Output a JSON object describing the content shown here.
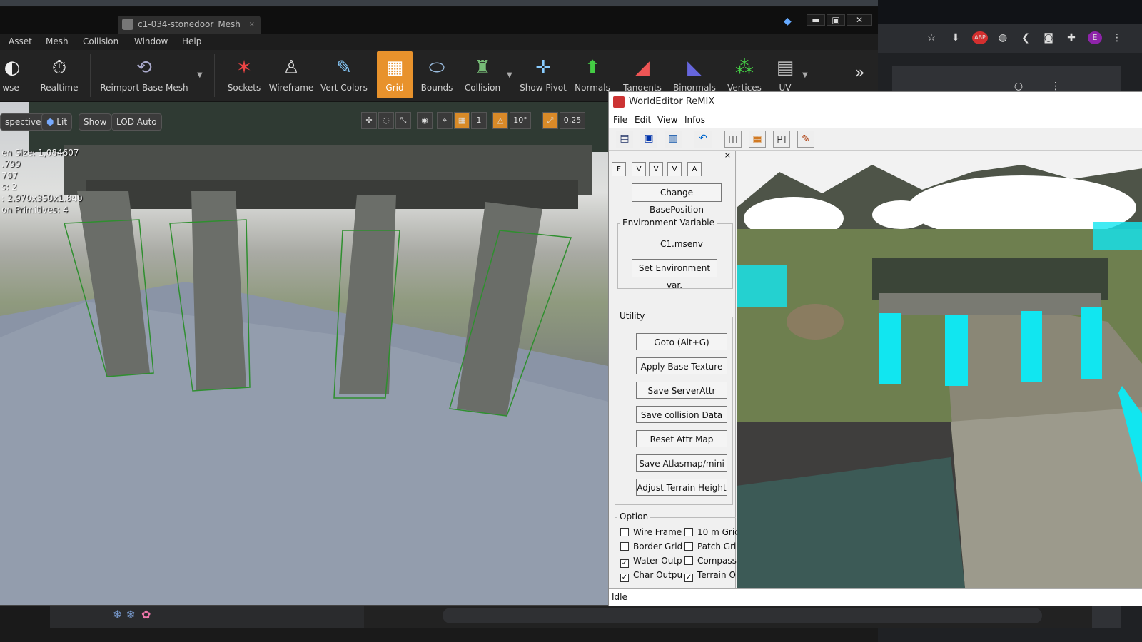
{
  "ue": {
    "tab_title": "c1-034-stonedoor_Mesh",
    "tab_close": "×",
    "window_buttons": {
      "minimize": "▬",
      "maximize": "▣",
      "close": "✕"
    },
    "menu": [
      "Asset",
      "Mesh",
      "Collision",
      "Window",
      "Help"
    ],
    "toolbar": [
      {
        "label": "wse",
        "icon": "browse-icon"
      },
      {
        "label": "Realtime",
        "icon": "realtime-icon"
      },
      {
        "label": "Reimport Base Mesh",
        "icon": "reimport-icon"
      },
      {
        "label": "Sockets",
        "icon": "sockets-icon"
      },
      {
        "label": "Wireframe",
        "icon": "wireframe-icon"
      },
      {
        "label": "Vert Colors",
        "icon": "vert-colors-icon"
      },
      {
        "label": "Grid",
        "icon": "grid-icon",
        "active": true
      },
      {
        "label": "Bounds",
        "icon": "bounds-icon"
      },
      {
        "label": "Collision",
        "icon": "collision-icon"
      },
      {
        "label": "Show Pivot",
        "icon": "show-pivot-icon"
      },
      {
        "label": "Normals",
        "icon": "normals-icon"
      },
      {
        "label": "Tangents",
        "icon": "tangents-icon"
      },
      {
        "label": "Binormals",
        "icon": "binormals-icon"
      },
      {
        "label": "Vertices",
        "icon": "vertices-icon"
      },
      {
        "label": "UV",
        "icon": "uv-icon"
      }
    ],
    "viewport": {
      "perspective": "spective",
      "lit": "Lit",
      "show": "Show",
      "lod": "LOD Auto",
      "grid_size": "1",
      "rotation_snap": "10°",
      "scale_snap": "0,25",
      "stats": [
        "en Size:  1,084607",
        ".799",
        "707",
        "s:  2",
        ":  2.970x350x1.840",
        "on Primitives:  4"
      ]
    }
  },
  "world_editor": {
    "title": "WorldEditor ReMIX",
    "menu": [
      "File",
      "Edit",
      "View",
      "Infos"
    ],
    "panel": {
      "close": "×",
      "tabs": [
        "F",
        "V",
        "V",
        "V",
        "A"
      ],
      "change_base_position": "Change BasePosition",
      "env_group": "Environment Variable",
      "env_value": "C1.msenv",
      "set_env": "Set Environment var.",
      "utility_group": "Utility",
      "utility_buttons": [
        "Goto (Alt+G)",
        "Apply Base Texture",
        "Save ServerAttr",
        "Save collision Data",
        "Reset Attr Map",
        "Save Atlasmap/mini",
        "Adjust Terrain Height"
      ],
      "option_group": "Option",
      "options": [
        {
          "label": "Wire Frame",
          "checked": false
        },
        {
          "label": "10 m Gric",
          "checked": false
        },
        {
          "label": "Border Grid",
          "checked": false
        },
        {
          "label": "Patch Gric",
          "checked": false
        },
        {
          "label": "Water Outp",
          "checked": true
        },
        {
          "label": "Compass",
          "checked": false
        },
        {
          "label": "Char Outpu",
          "checked": true
        },
        {
          "label": "Terrain O",
          "checked": true
        }
      ]
    },
    "status": "Idle"
  },
  "browser": {
    "avatar": "E",
    "abp": "ABP"
  },
  "colors": {
    "accent": "#e8922c",
    "cyan": "#11e6f0"
  }
}
